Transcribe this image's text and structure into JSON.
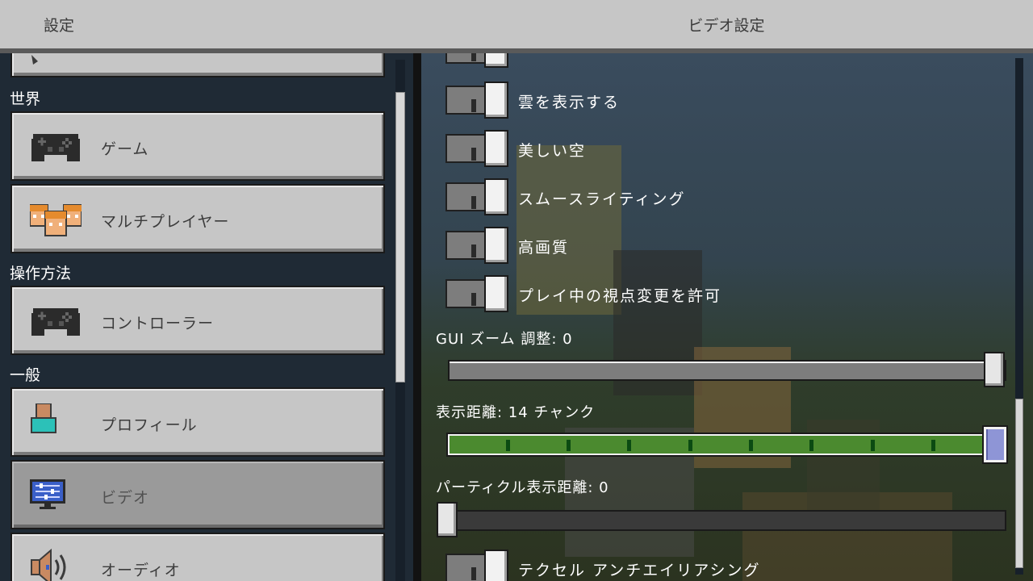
{
  "header": {
    "left_title": "設定",
    "page_title": "ビデオ設定"
  },
  "sidebar": {
    "sections": [
      {
        "title": "世界"
      },
      {
        "title": "操作方法"
      },
      {
        "title": "一般"
      }
    ],
    "items": [
      {
        "label": "ゲーム",
        "icon": "controller-icon"
      },
      {
        "label": "マルチプレイヤー",
        "icon": "players-icon"
      },
      {
        "label": "コントローラー",
        "icon": "controller-icon"
      },
      {
        "label": "プロフィール",
        "icon": "profile-icon"
      },
      {
        "label": "ビデオ",
        "icon": "monitor-icon",
        "selected": true
      },
      {
        "label": "オーディオ",
        "icon": "speaker-icon"
      }
    ]
  },
  "video": {
    "toggles": [
      {
        "label": "雲を表示する",
        "on": false
      },
      {
        "label": "美しい空",
        "on": false
      },
      {
        "label": "スムースライティング",
        "on": false
      },
      {
        "label": "高画質",
        "on": false
      },
      {
        "label": "プレイ中の視点変更を許可",
        "on": false
      },
      {
        "label": "テクセル アンチエイリアシング",
        "on": false
      }
    ],
    "gui_zoom": {
      "label": "GUI ズーム 調整: 0",
      "value": 1.0
    },
    "render_distance": {
      "label": "表示距離: 14 チャンク",
      "value": 1.0
    },
    "particle_distance": {
      "label": "パーティクル表示距離: 0",
      "value": 0.0
    }
  },
  "colors": {
    "header_bg": "#c6c6c6",
    "button_bg": "#c6c6c6",
    "selected_bg": "#9a9a9a",
    "slider_green": "#4b8a2f",
    "knob_blue": "#8e95d6"
  }
}
